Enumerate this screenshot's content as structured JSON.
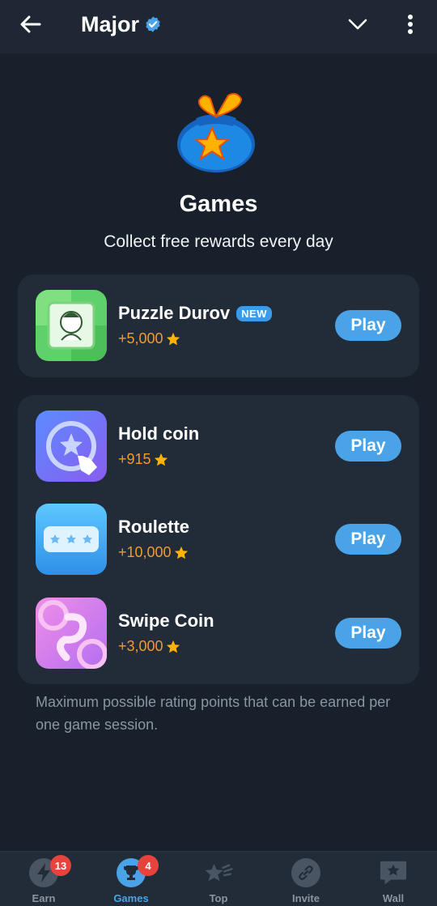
{
  "header": {
    "title": "Major"
  },
  "hero": {
    "title": "Games",
    "subtitle": "Collect free rewards every day"
  },
  "featured": {
    "name": "Puzzle Durov",
    "badge": "NEW",
    "reward": "+5,000",
    "play_label": "Play"
  },
  "games": [
    {
      "name": "Hold coin",
      "reward": "+915",
      "play_label": "Play"
    },
    {
      "name": "Roulette",
      "reward": "+10,000",
      "play_label": "Play"
    },
    {
      "name": "Swipe Coin",
      "reward": "+3,000",
      "play_label": "Play"
    }
  ],
  "footnote": "Maximum possible rating points that can be earned per one game session.",
  "nav": {
    "items": [
      {
        "label": "Earn",
        "badge": "13",
        "icon": "lightning-icon"
      },
      {
        "label": "Games",
        "badge": "4",
        "icon": "trophy-icon"
      },
      {
        "label": "Top",
        "icon": "stars-icon"
      },
      {
        "label": "Invite",
        "icon": "link-icon"
      },
      {
        "label": "Wall",
        "icon": "star-message-icon"
      }
    ]
  },
  "colors": {
    "background": "#18202b",
    "card": "#222c39",
    "accent": "#4aa3e6",
    "reward": "#f29a2c",
    "badge": "#e8423d"
  }
}
